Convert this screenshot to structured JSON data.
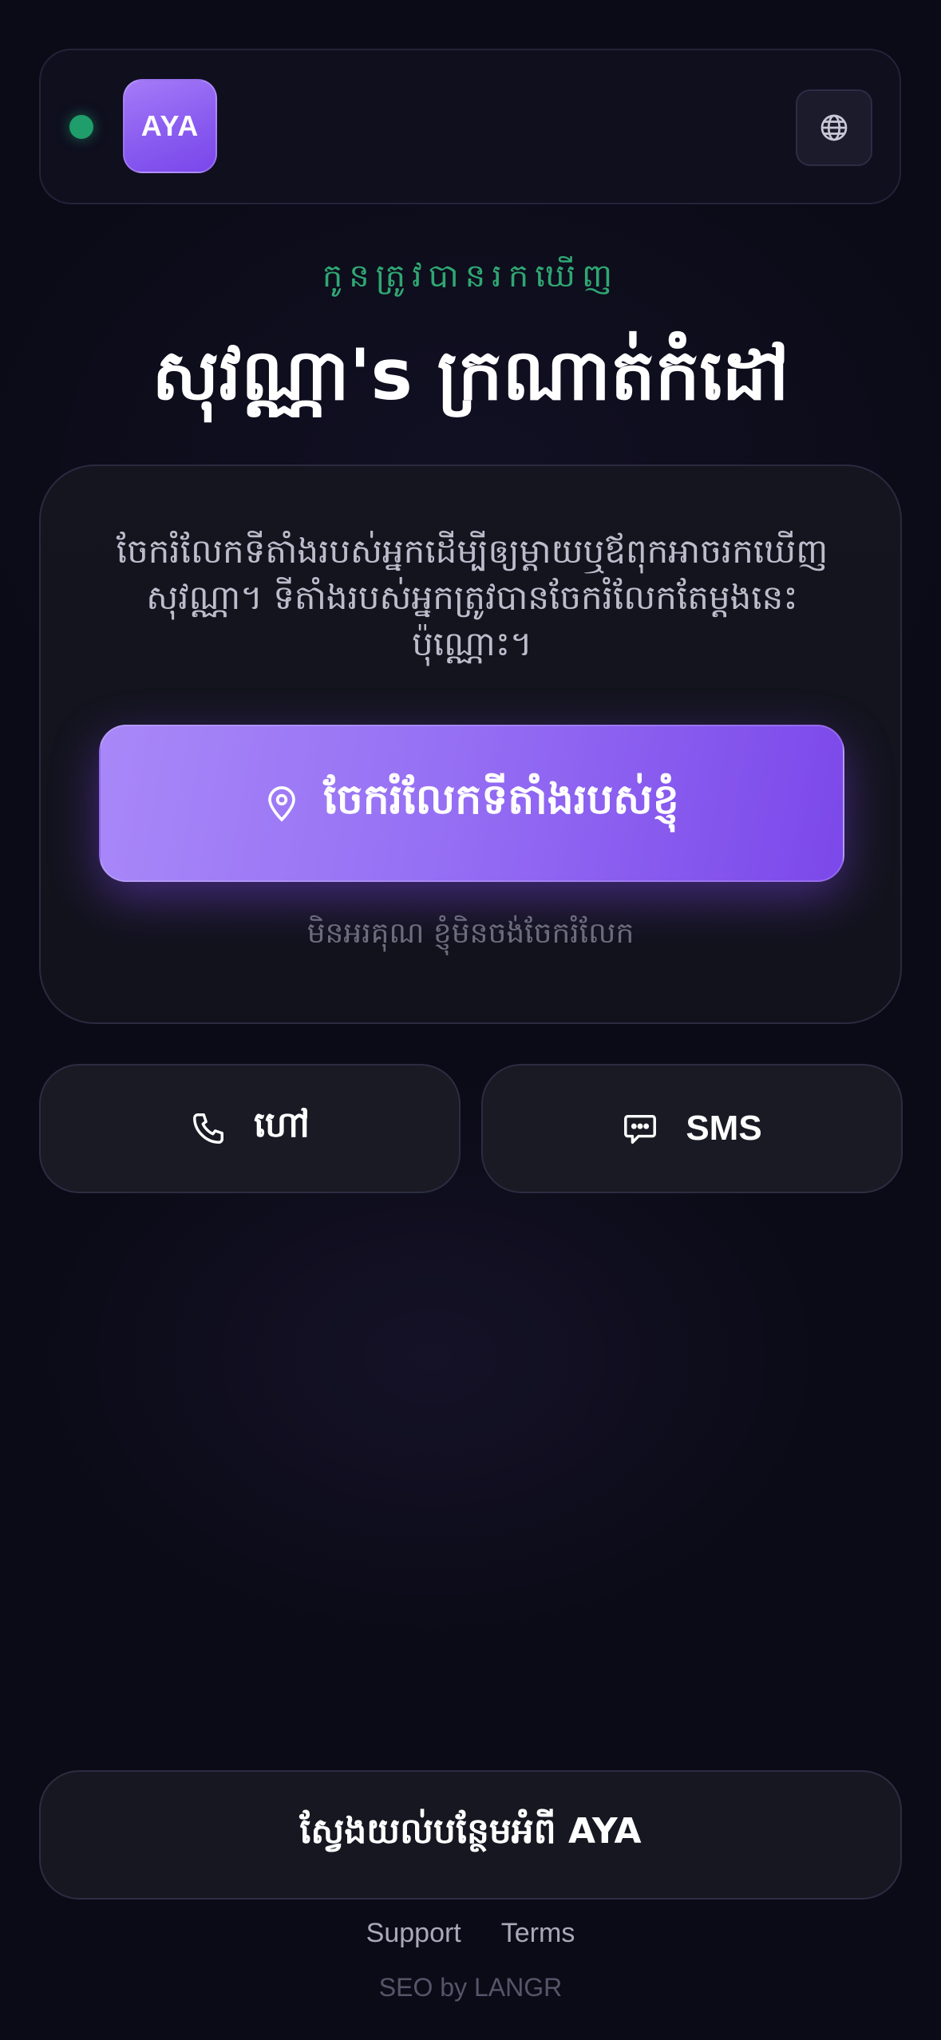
{
  "header": {
    "status": "online",
    "logo_text": "AYA",
    "language_icon": "globe-icon"
  },
  "hero": {
    "subtitle": "កូនត្រូវបានរកឃើញ",
    "title": "សុវណ្ណា's ក្រណាត់កំដៅ"
  },
  "card": {
    "description": "ចែករំលែកទីតាំងរបស់អ្នកដើម្បីឲ្យម្ដាយឬឪពុកអាចរកឃើញ សុវណ្ណា។ ទីតាំងរបស់អ្នកត្រូវបានចែករំលែកតែម្ដងនេះប៉ុណ្ណោះ។",
    "share_label": "ចែករំលែកទីតាំងរបស់ខ្ញុំ",
    "share_icon": "location-pin-icon",
    "decline_label": "មិនអរគុណ ខ្ញុំមិនចង់ចែករំលែក"
  },
  "actions": {
    "call_label": "ហៅ",
    "call_icon": "phone-icon",
    "sms_label": "SMS",
    "sms_icon": "chat-bubble-icon"
  },
  "learn_more": {
    "label": "ស្វែងយល់បន្ថែមអំពី AYA"
  },
  "footer": {
    "support": "Support",
    "terms": "Terms",
    "credit": "SEO by LANGR"
  },
  "colors": {
    "background": "#0b0b17",
    "accent": "#8a5cf0",
    "status_green": "#1f9d6b"
  }
}
